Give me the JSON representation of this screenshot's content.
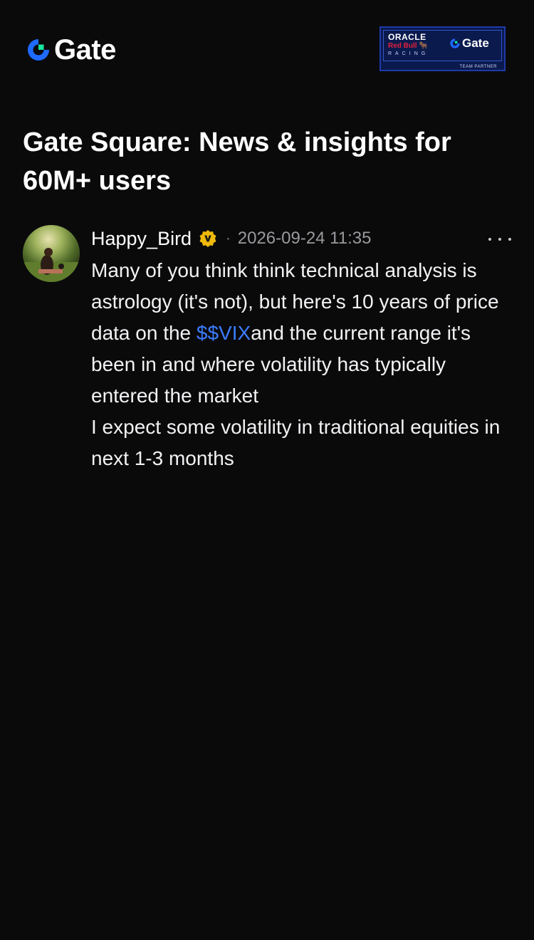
{
  "header": {
    "logo_text": "Gate",
    "partner": {
      "oracle": "ORACLE",
      "redbull": "Red Bull",
      "racing": "RACING",
      "gate": "Gate",
      "team": "TEAM PARTNER"
    }
  },
  "page": {
    "title": "Gate Square: News & insights for 60M+ users"
  },
  "post": {
    "username": "Happy_Bird",
    "separator": "·",
    "timestamp": "2026-09-24 11:35",
    "body_part1": "Many of you think think technical analysis is astrology (it's not), but here's 10 years of price data on the ",
    "cashtag": "$$VIX",
    "body_part2": "and the current range it's been in and where volatility has typically entered the market",
    "body_line2": "I expect some volatility in traditional equities in next 1-3 months"
  },
  "colors": {
    "background": "#0a0a0b",
    "accent_blue": "#3b7dff",
    "verified_gold": "#f0b90b",
    "brand_green": "#17e5a0"
  },
  "icons": {
    "logo": "gate-logo-icon",
    "verified": "verified-badge-icon",
    "more": "more-horizontal-icon"
  }
}
